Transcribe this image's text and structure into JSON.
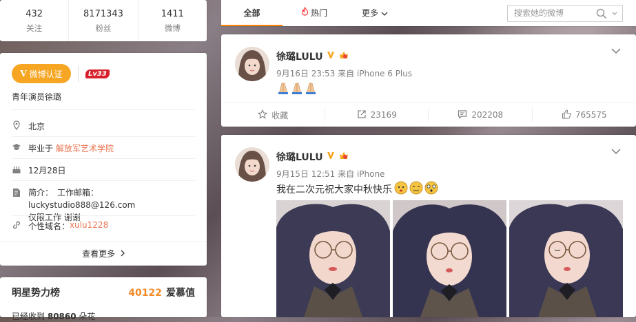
{
  "stats": [
    {
      "num": "432",
      "label": "关注"
    },
    {
      "num": "8171343",
      "label": "粉丝"
    },
    {
      "num": "1411",
      "label": "微博"
    }
  ],
  "profile": {
    "verify_label": "微博认证",
    "verify_v": "V",
    "level": "Lv33",
    "bio": "青年演员徐璐",
    "location": "北京",
    "school_prefix": "毕业于",
    "school": "解放军艺术学院",
    "birthday": "12月28日",
    "intro_label": "简介：",
    "intro_line1": "工作邮箱：luckystudio888@126.com",
    "intro_line2": "仅限工作 谢谢",
    "domain_label": "个性域名：",
    "domain": "xulu1228",
    "more": "查看更多"
  },
  "rank": {
    "title": "明星势力榜",
    "value": "40122",
    "unit": "爱慕值",
    "sub_prefix": "已经收到",
    "sub_value": "80860",
    "sub_suffix": "朵花"
  },
  "tabs": {
    "all": "全部",
    "hot": "热门",
    "more": "更多",
    "search_placeholder": "搜索她的微博"
  },
  "posts": [
    {
      "name": "徐璐LULU",
      "meta": "9月16日 23:53 来自 iPhone 6 Plus",
      "actions": {
        "fav": "收藏",
        "share": "23169",
        "comment": "202208",
        "like": "765575"
      }
    },
    {
      "name": "徐璐LULU",
      "meta": "9月15日 12:51 来自 iPhone",
      "text": "我在二次元祝大家中秋快乐"
    }
  ],
  "colors": {
    "accent": "#ff8200",
    "verify": "#f6a623",
    "level": "#d8202d",
    "link": "#eb7350",
    "rank_value": "#f28a28"
  }
}
